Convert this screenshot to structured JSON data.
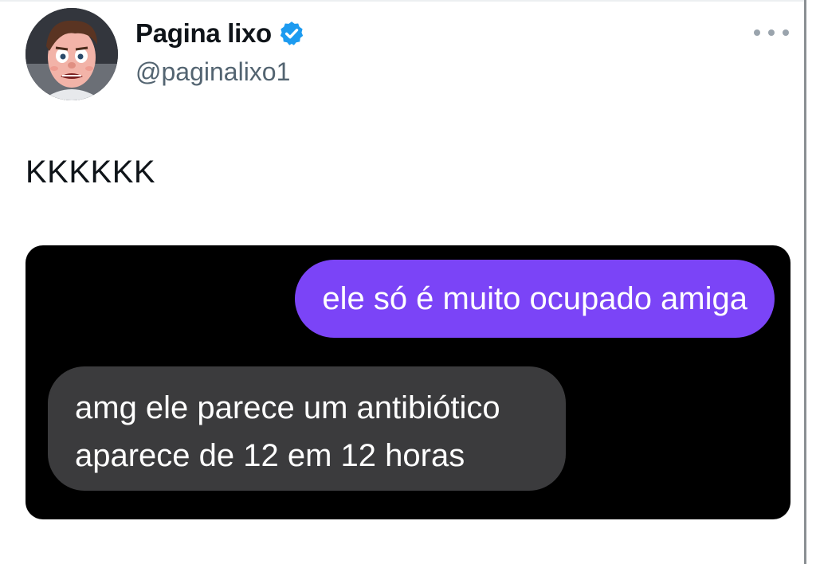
{
  "author": {
    "display_name": "Pagina lixo",
    "handle": "@paginalixo1",
    "verified": true,
    "avatar_icon": "cartoon-face-avatar"
  },
  "tweet": {
    "text": "KKKKKK"
  },
  "media": {
    "messages": [
      {
        "direction": "sent",
        "lines": [
          "ele só é muito ocupado amiga"
        ]
      },
      {
        "direction": "received",
        "lines": [
          "amg ele parece um antibiótico",
          "aparece de 12 em 12 horas"
        ]
      }
    ]
  },
  "colors": {
    "verified_badge": "#1d9bf0",
    "sent_bubble": "#7b44f7",
    "received_bubble": "#3b3b3d",
    "handle_text": "#536471"
  },
  "icons": {
    "more": "more-horizontal-icon",
    "verified": "verified-badge-icon"
  }
}
